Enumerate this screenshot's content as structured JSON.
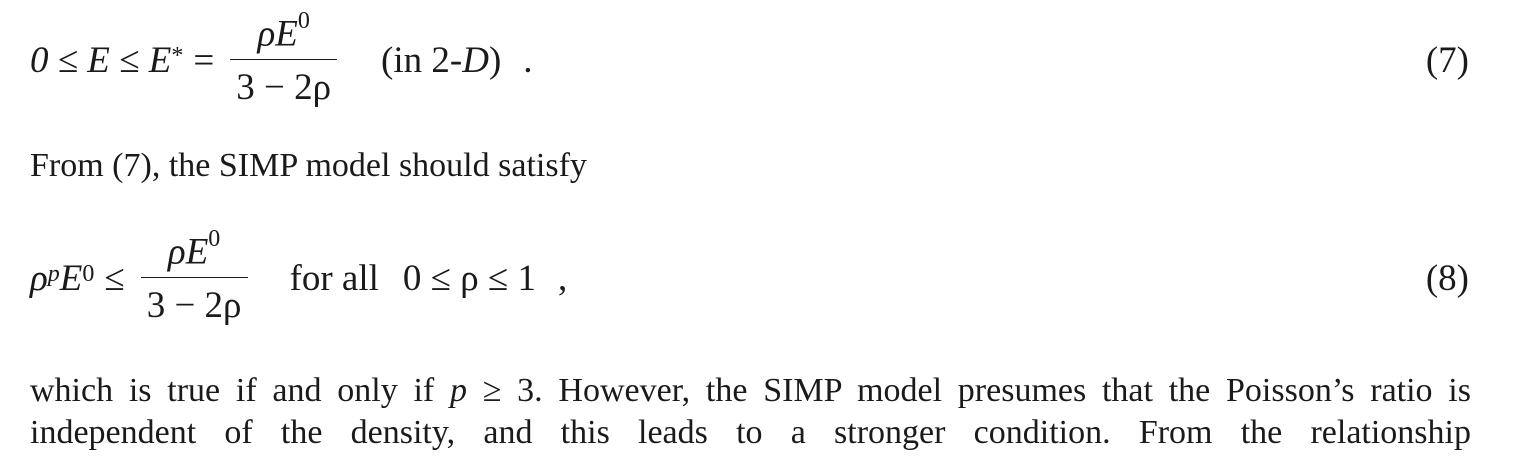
{
  "eq7": {
    "lhs": "0 ≤ E ≤ E",
    "lhs_star": "*",
    "eq": "=",
    "num_rho": "ρ",
    "num_E": "E",
    "num_sup": "0",
    "den": "3 − 2ρ",
    "note_open": "(in 2-",
    "note_D": "D",
    "note_close": ")",
    "period": ".",
    "label": "(7)"
  },
  "para1": {
    "text": "From (7), the SIMP model should satisfy"
  },
  "eq8": {
    "rho": "ρ",
    "p": "p",
    "E": "E",
    "E_sup": "0",
    "leq": "≤",
    "num_rho": "ρ",
    "num_E": "E",
    "num_sup": "0",
    "den": "3 − 2ρ",
    "forall": "for all",
    "range": "0 ≤ ρ ≤ 1",
    "comma": ",",
    "label": "(8)"
  },
  "para2": {
    "line1_a": "which is true if and only if ",
    "line1_p": "p",
    "line1_b": " ≥ 3. However, the SIMP model presumes that the Poisson’s ratio is",
    "line2": "independent of the density, and this leads to a stronger condition. From the relationship"
  }
}
